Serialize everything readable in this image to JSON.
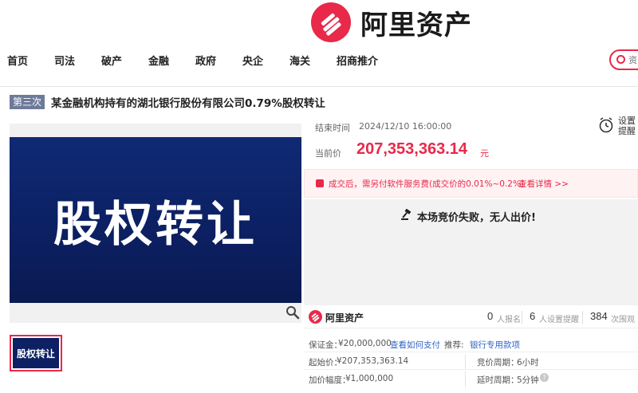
{
  "brand": {
    "name": "阿里资产",
    "color": "#e8294a"
  },
  "nav": {
    "items": [
      {
        "label": "首页"
      },
      {
        "label": "司法"
      },
      {
        "label": "破产"
      },
      {
        "label": "金融"
      },
      {
        "label": "政府"
      },
      {
        "label": "央企"
      },
      {
        "label": "海关"
      },
      {
        "label": "招商推介"
      }
    ],
    "search_placeholder": "资"
  },
  "listing": {
    "round": "第三次",
    "title": "某金融机构持有的湖北银行股份有限公司0.79%股权转让",
    "image_text": "股权转让",
    "thumb_text": "股权转让"
  },
  "auction": {
    "end_label": "结束时间",
    "end_time": "2024/12/10 16:00:00",
    "reminder": [
      "设置",
      "提醒"
    ],
    "current_label": "当前价",
    "current_price": "207,353,363.14",
    "currency_unit": "元",
    "notice": "成交后，需另付软件服务费(成交价的0.01%~0.2%)",
    "notice_link": "查看详情 >>",
    "status": "本场竞价失败，无人出价!"
  },
  "stats": {
    "brand": "阿里资产",
    "signups": {
      "value": "0",
      "label": "人报名"
    },
    "reminders": {
      "value": "6",
      "label": "人设置提醒"
    },
    "views": {
      "value": "384",
      "label": "次围观"
    }
  },
  "details": {
    "deposit_label": "保证金：",
    "deposit": "¥20,000,000",
    "deposit_link": "查看如何支付",
    "recommend_label": "推荐:",
    "recommend_link": "银行专用款项",
    "start_label": "起始价：",
    "start_price": "¥207,353,363.14",
    "bid_period_label": "竞价周期：",
    "bid_period": "6小时",
    "increment_label": "加价幅度：",
    "increment": "¥1,000,000",
    "extend_label": "延时周期：",
    "extend": "5分钟",
    "help_icon": "?"
  }
}
